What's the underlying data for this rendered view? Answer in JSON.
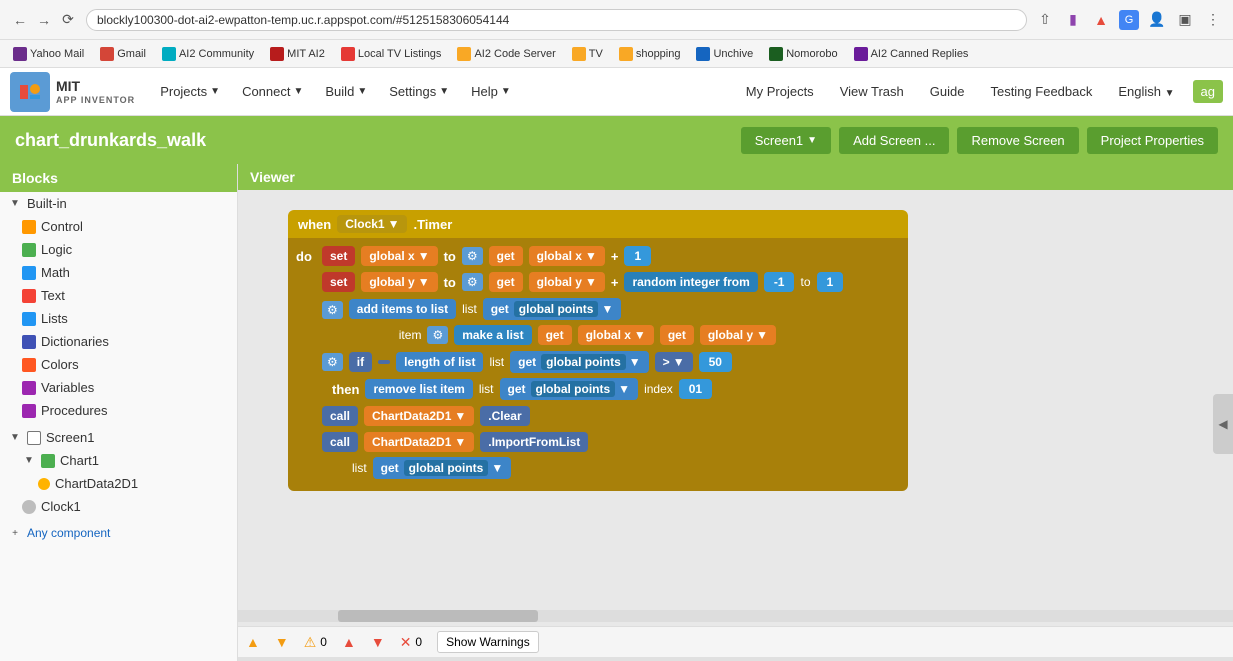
{
  "browser": {
    "url": "blockly100300-dot-ai2-ewpatton-temp.uc.r.appspot.com/#5125158306054144",
    "bookmarks": [
      {
        "label": "Yahoo Mail",
        "color": "#6b2d8b"
      },
      {
        "label": "Gmail",
        "color": "#d44638"
      },
      {
        "label": "AI2 Community",
        "color": "#00acc1"
      },
      {
        "label": "MIT AI2",
        "color": "#b71c1c"
      },
      {
        "label": "Local TV Listings",
        "color": "#e53935"
      },
      {
        "label": "AI2 Code Server",
        "color": "#f9a825"
      },
      {
        "label": "TV",
        "color": "#f9a825"
      },
      {
        "label": "shopping",
        "color": "#f9a825"
      },
      {
        "label": "Unchive",
        "color": "#1565c0"
      },
      {
        "label": "Nomorobo",
        "color": "#1b5e20"
      },
      {
        "label": "AI2 Canned Replies",
        "color": "#6a1b9a"
      }
    ]
  },
  "app": {
    "logo_line1": "MIT",
    "logo_line2": "APP INVENTOR",
    "nav_items": [
      "Projects",
      "Connect",
      "Build",
      "Settings",
      "Help"
    ],
    "nav_right": [
      "My Projects",
      "View Trash",
      "Guide",
      "Testing Feedback",
      "English",
      "ag"
    ]
  },
  "project": {
    "title": "chart_drunkards_walk",
    "screen_label": "Screen1",
    "btn_add": "Add Screen ...",
    "btn_remove": "Remove Screen",
    "btn_properties": "Project Properties"
  },
  "blocks_panel": {
    "header": "Blocks",
    "builtin_label": "Built-in",
    "items": [
      {
        "label": "Control",
        "color": "icon-control"
      },
      {
        "label": "Logic",
        "color": "icon-logic"
      },
      {
        "label": "Math",
        "color": "icon-math"
      },
      {
        "label": "Text",
        "color": "icon-text"
      },
      {
        "label": "Lists",
        "color": "icon-lists"
      },
      {
        "label": "Dictionaries",
        "color": "icon-dicts"
      },
      {
        "label": "Colors",
        "color": "icon-colors"
      },
      {
        "label": "Variables",
        "color": "icon-vars"
      },
      {
        "label": "Procedures",
        "color": "icon-procs"
      }
    ],
    "screen1_label": "Screen1",
    "chart1_label": "Chart1",
    "chartdata_label": "ChartData2D1",
    "clock_label": "Clock1",
    "any_component": "Any component"
  },
  "viewer": {
    "header": "Viewer"
  },
  "blocks": {
    "when_event": "when",
    "clock1": "Clock1",
    "timer": ".Timer",
    "do": "do",
    "set": "set",
    "global_x": "global x",
    "to": "to",
    "get": "get",
    "global_y": "global y",
    "plus": "+",
    "one": "1",
    "global_points": "global points",
    "neg_one": "-1",
    "random_integer_from": "random integer from",
    "add_items_to_list": "add items to list",
    "list_label": "list",
    "item_label": "item",
    "make_a_list": "make a list",
    "if_label": "if",
    "length_of_list": "length of list",
    "greater_than": ">",
    "fifty": "50",
    "then": "then",
    "remove_list_item": "remove list item",
    "index": "index",
    "zero_one": "01",
    "call": "call",
    "chartdata2d1": "ChartData2D1",
    "clear": ".Clear",
    "importfromlist": ".ImportFromList",
    "list_label2": "list"
  },
  "warnings": {
    "warn_count": "0",
    "err_count": "0",
    "show_btn": "Show Warnings"
  }
}
